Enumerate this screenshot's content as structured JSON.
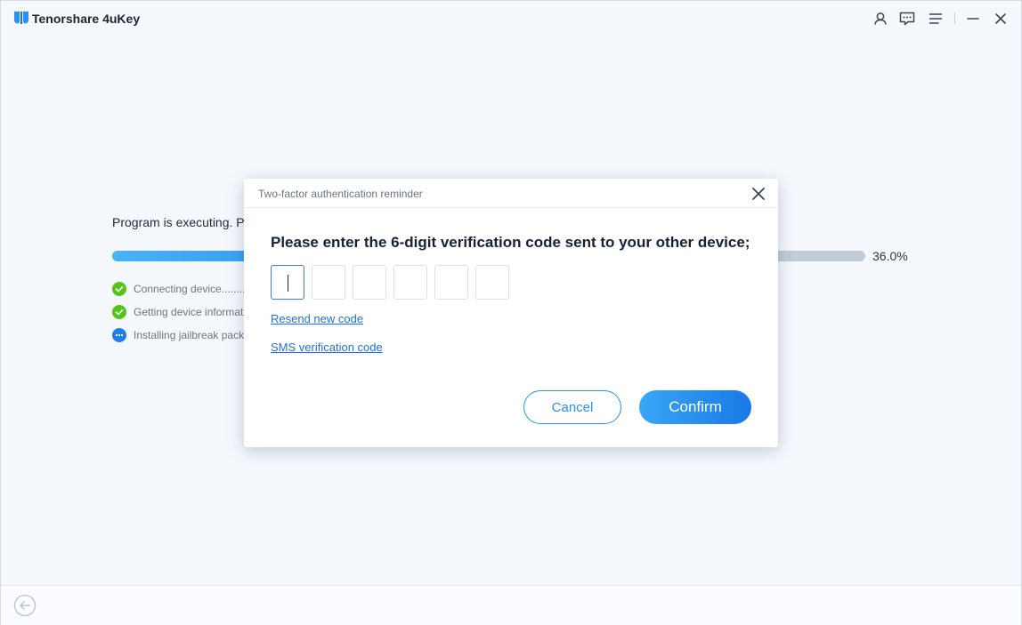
{
  "app": {
    "title": "Tenorshare 4uKey",
    "icons": [
      "user-icon",
      "feedback-icon",
      "menu-icon",
      "minimize-icon",
      "close-icon"
    ]
  },
  "progress": {
    "status_text": "Program is executing. Pl",
    "percent_label": "36.0%",
    "percent_value": 36.0,
    "steps": [
      {
        "label": "Connecting device.........",
        "status": "done"
      },
      {
        "label": "Getting device informat",
        "status": "done"
      },
      {
        "label": "Installing jailbreak pack",
        "status": "in-progress"
      }
    ]
  },
  "dialog": {
    "title": "Two-factor authentication reminder",
    "heading": "Please enter the 6-digit verification code sent to your other device;",
    "code_digits": [
      "",
      "",
      "",
      "",
      "",
      ""
    ],
    "resend_link": "Resend new code",
    "sms_link": "SMS verification code",
    "cancel_label": "Cancel",
    "confirm_label": "Confirm"
  },
  "colors": {
    "accent": "#2d8ff0",
    "link": "#1f72d6",
    "success": "#52c41a",
    "background": "#f5f8fd"
  }
}
